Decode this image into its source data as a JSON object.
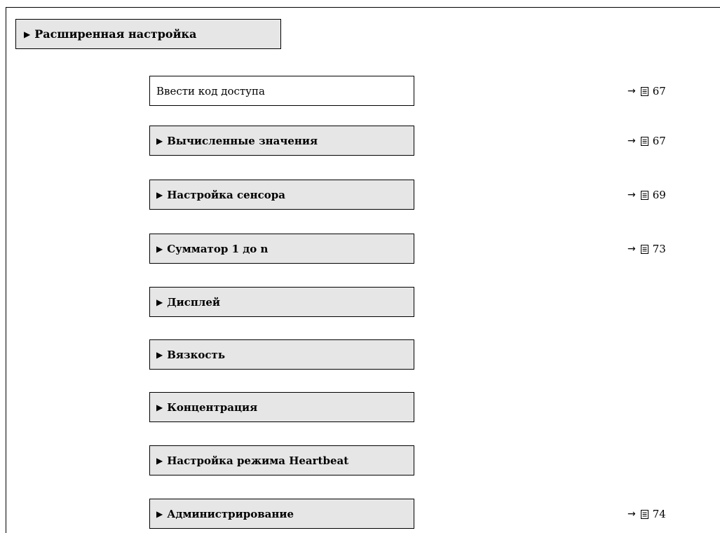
{
  "header": {
    "marker": "▶",
    "label": "Расширенная настройка"
  },
  "items": [
    {
      "type": "param",
      "marker": "",
      "label": "Ввести код доступа",
      "ref_arrow": "→",
      "ref_page": "67"
    },
    {
      "type": "submenu",
      "marker": "▶",
      "label": "Вычисленные значения",
      "ref_arrow": "→",
      "ref_page": "67"
    },
    {
      "type": "submenu",
      "marker": "▶",
      "label": "Настройка сенсора",
      "ref_arrow": "→",
      "ref_page": "69"
    },
    {
      "type": "submenu",
      "marker": "▶",
      "label": "Сумматор 1 до n",
      "ref_arrow": "→",
      "ref_page": "73"
    },
    {
      "type": "submenu",
      "marker": "▶",
      "label": "Дисплей",
      "ref_arrow": "",
      "ref_page": ""
    },
    {
      "type": "submenu",
      "marker": "▶",
      "label": "Вязкость",
      "ref_arrow": "",
      "ref_page": ""
    },
    {
      "type": "submenu",
      "marker": "▶",
      "label": "Концентрация",
      "ref_arrow": "",
      "ref_page": ""
    },
    {
      "type": "submenu",
      "marker": "▶",
      "label": "Настройка режима Heartbeat",
      "ref_arrow": "",
      "ref_page": ""
    },
    {
      "type": "submenu",
      "marker": "▶",
      "label": "Администрирование",
      "ref_arrow": "→",
      "ref_page": "74"
    }
  ],
  "colors": {
    "submenu_fill": "#e6e6e6",
    "param_fill": "#ffffff",
    "border": "#000000"
  },
  "icons": {
    "ref_icon": "book-page-icon",
    "marker_icon": "triangle-right-icon"
  }
}
